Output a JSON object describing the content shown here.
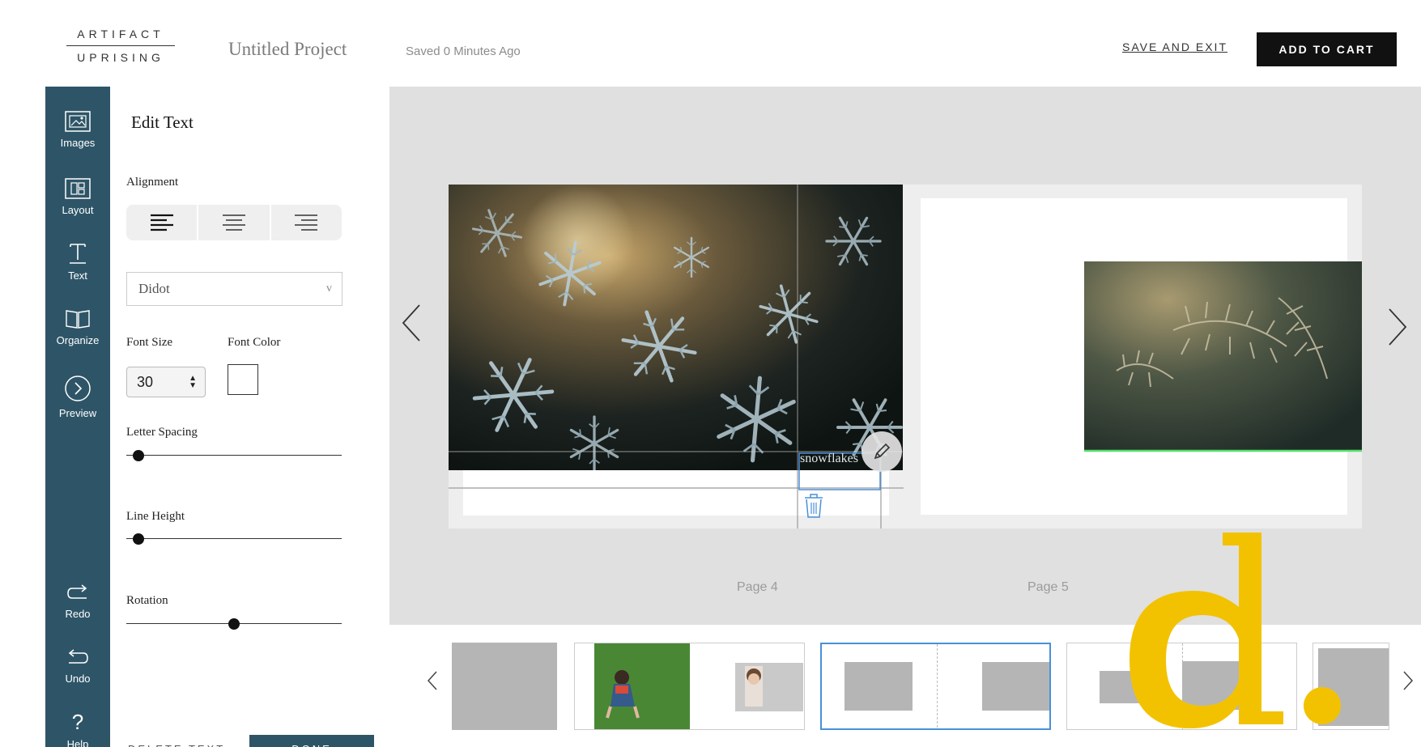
{
  "header": {
    "logo_line1": "ARTIFACT",
    "logo_line2": "UPRISING",
    "project_title": "Untitled Project",
    "saved_status": "Saved 0 Minutes Ago",
    "save_exit_label": "SAVE AND EXIT",
    "add_to_cart_label": "ADD TO CART"
  },
  "rail": {
    "images": "Images",
    "layout": "Layout",
    "text": "Text",
    "organize": "Organize",
    "preview": "Preview",
    "redo": "Redo",
    "undo": "Undo",
    "help_glyph": "?",
    "help": "Help"
  },
  "panel": {
    "title": "Edit Text",
    "alignment_label": "Alignment",
    "font_value": "Didot",
    "font_size_label": "Font Size",
    "font_size_value": "30",
    "font_color_label": "Font Color",
    "letter_spacing_label": "Letter Spacing",
    "letter_spacing_level": 0.03,
    "line_height_label": "Line Height",
    "line_height_level": 0.03,
    "rotation_label": "Rotation",
    "rotation_level": 0.5,
    "delete_label": "DELETE TEXT",
    "done_label": "DONE"
  },
  "canvas": {
    "caption_text": "snowflakes",
    "page_left_label": "Page 4",
    "page_right_label": "Page 5"
  },
  "colors": {
    "rail": "#2e5567",
    "accent_selected": "#4a90d9",
    "watermark": "#f2c200",
    "green_line": "#56e06a"
  },
  "icons": [
    "image-icon",
    "layout-icon",
    "text-icon",
    "book-icon",
    "chevron-circle-icon",
    "redo-icon",
    "undo-icon",
    "help-icon",
    "pencil-icon",
    "trash-icon"
  ]
}
